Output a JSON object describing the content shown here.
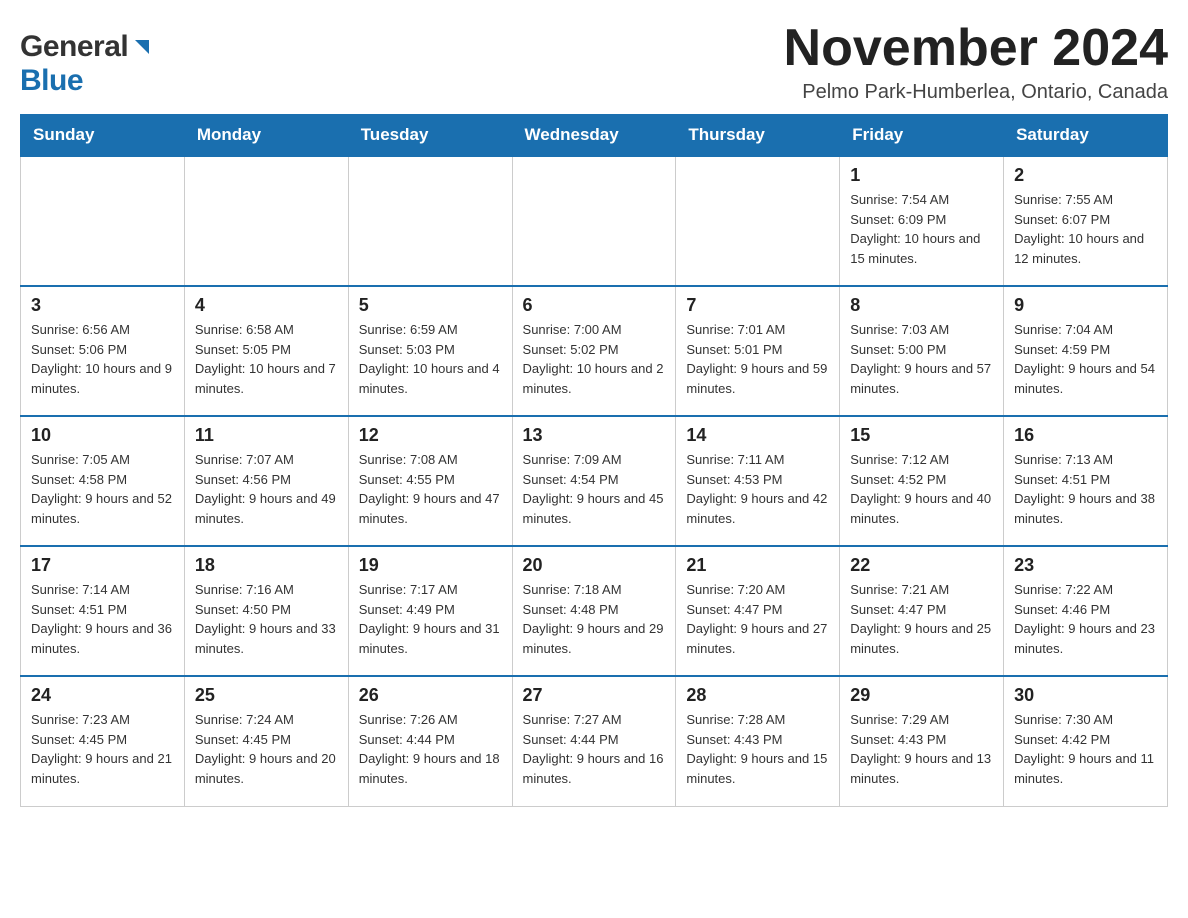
{
  "logo": {
    "text_general": "General",
    "triangle_symbol": "▶",
    "text_blue": "Blue"
  },
  "title": "November 2024",
  "location": "Pelmo Park-Humberlea, Ontario, Canada",
  "weekdays": [
    "Sunday",
    "Monday",
    "Tuesday",
    "Wednesday",
    "Thursday",
    "Friday",
    "Saturday"
  ],
  "weeks": [
    [
      {
        "day": "",
        "sunrise": "",
        "sunset": "",
        "daylight": ""
      },
      {
        "day": "",
        "sunrise": "",
        "sunset": "",
        "daylight": ""
      },
      {
        "day": "",
        "sunrise": "",
        "sunset": "",
        "daylight": ""
      },
      {
        "day": "",
        "sunrise": "",
        "sunset": "",
        "daylight": ""
      },
      {
        "day": "",
        "sunrise": "",
        "sunset": "",
        "daylight": ""
      },
      {
        "day": "1",
        "sunrise": "Sunrise: 7:54 AM",
        "sunset": "Sunset: 6:09 PM",
        "daylight": "Daylight: 10 hours and 15 minutes."
      },
      {
        "day": "2",
        "sunrise": "Sunrise: 7:55 AM",
        "sunset": "Sunset: 6:07 PM",
        "daylight": "Daylight: 10 hours and 12 minutes."
      }
    ],
    [
      {
        "day": "3",
        "sunrise": "Sunrise: 6:56 AM",
        "sunset": "Sunset: 5:06 PM",
        "daylight": "Daylight: 10 hours and 9 minutes."
      },
      {
        "day": "4",
        "sunrise": "Sunrise: 6:58 AM",
        "sunset": "Sunset: 5:05 PM",
        "daylight": "Daylight: 10 hours and 7 minutes."
      },
      {
        "day": "5",
        "sunrise": "Sunrise: 6:59 AM",
        "sunset": "Sunset: 5:03 PM",
        "daylight": "Daylight: 10 hours and 4 minutes."
      },
      {
        "day": "6",
        "sunrise": "Sunrise: 7:00 AM",
        "sunset": "Sunset: 5:02 PM",
        "daylight": "Daylight: 10 hours and 2 minutes."
      },
      {
        "day": "7",
        "sunrise": "Sunrise: 7:01 AM",
        "sunset": "Sunset: 5:01 PM",
        "daylight": "Daylight: 9 hours and 59 minutes."
      },
      {
        "day": "8",
        "sunrise": "Sunrise: 7:03 AM",
        "sunset": "Sunset: 5:00 PM",
        "daylight": "Daylight: 9 hours and 57 minutes."
      },
      {
        "day": "9",
        "sunrise": "Sunrise: 7:04 AM",
        "sunset": "Sunset: 4:59 PM",
        "daylight": "Daylight: 9 hours and 54 minutes."
      }
    ],
    [
      {
        "day": "10",
        "sunrise": "Sunrise: 7:05 AM",
        "sunset": "Sunset: 4:58 PM",
        "daylight": "Daylight: 9 hours and 52 minutes."
      },
      {
        "day": "11",
        "sunrise": "Sunrise: 7:07 AM",
        "sunset": "Sunset: 4:56 PM",
        "daylight": "Daylight: 9 hours and 49 minutes."
      },
      {
        "day": "12",
        "sunrise": "Sunrise: 7:08 AM",
        "sunset": "Sunset: 4:55 PM",
        "daylight": "Daylight: 9 hours and 47 minutes."
      },
      {
        "day": "13",
        "sunrise": "Sunrise: 7:09 AM",
        "sunset": "Sunset: 4:54 PM",
        "daylight": "Daylight: 9 hours and 45 minutes."
      },
      {
        "day": "14",
        "sunrise": "Sunrise: 7:11 AM",
        "sunset": "Sunset: 4:53 PM",
        "daylight": "Daylight: 9 hours and 42 minutes."
      },
      {
        "day": "15",
        "sunrise": "Sunrise: 7:12 AM",
        "sunset": "Sunset: 4:52 PM",
        "daylight": "Daylight: 9 hours and 40 minutes."
      },
      {
        "day": "16",
        "sunrise": "Sunrise: 7:13 AM",
        "sunset": "Sunset: 4:51 PM",
        "daylight": "Daylight: 9 hours and 38 minutes."
      }
    ],
    [
      {
        "day": "17",
        "sunrise": "Sunrise: 7:14 AM",
        "sunset": "Sunset: 4:51 PM",
        "daylight": "Daylight: 9 hours and 36 minutes."
      },
      {
        "day": "18",
        "sunrise": "Sunrise: 7:16 AM",
        "sunset": "Sunset: 4:50 PM",
        "daylight": "Daylight: 9 hours and 33 minutes."
      },
      {
        "day": "19",
        "sunrise": "Sunrise: 7:17 AM",
        "sunset": "Sunset: 4:49 PM",
        "daylight": "Daylight: 9 hours and 31 minutes."
      },
      {
        "day": "20",
        "sunrise": "Sunrise: 7:18 AM",
        "sunset": "Sunset: 4:48 PM",
        "daylight": "Daylight: 9 hours and 29 minutes."
      },
      {
        "day": "21",
        "sunrise": "Sunrise: 7:20 AM",
        "sunset": "Sunset: 4:47 PM",
        "daylight": "Daylight: 9 hours and 27 minutes."
      },
      {
        "day": "22",
        "sunrise": "Sunrise: 7:21 AM",
        "sunset": "Sunset: 4:47 PM",
        "daylight": "Daylight: 9 hours and 25 minutes."
      },
      {
        "day": "23",
        "sunrise": "Sunrise: 7:22 AM",
        "sunset": "Sunset: 4:46 PM",
        "daylight": "Daylight: 9 hours and 23 minutes."
      }
    ],
    [
      {
        "day": "24",
        "sunrise": "Sunrise: 7:23 AM",
        "sunset": "Sunset: 4:45 PM",
        "daylight": "Daylight: 9 hours and 21 minutes."
      },
      {
        "day": "25",
        "sunrise": "Sunrise: 7:24 AM",
        "sunset": "Sunset: 4:45 PM",
        "daylight": "Daylight: 9 hours and 20 minutes."
      },
      {
        "day": "26",
        "sunrise": "Sunrise: 7:26 AM",
        "sunset": "Sunset: 4:44 PM",
        "daylight": "Daylight: 9 hours and 18 minutes."
      },
      {
        "day": "27",
        "sunrise": "Sunrise: 7:27 AM",
        "sunset": "Sunset: 4:44 PM",
        "daylight": "Daylight: 9 hours and 16 minutes."
      },
      {
        "day": "28",
        "sunrise": "Sunrise: 7:28 AM",
        "sunset": "Sunset: 4:43 PM",
        "daylight": "Daylight: 9 hours and 15 minutes."
      },
      {
        "day": "29",
        "sunrise": "Sunrise: 7:29 AM",
        "sunset": "Sunset: 4:43 PM",
        "daylight": "Daylight: 9 hours and 13 minutes."
      },
      {
        "day": "30",
        "sunrise": "Sunrise: 7:30 AM",
        "sunset": "Sunset: 4:42 PM",
        "daylight": "Daylight: 9 hours and 11 minutes."
      }
    ]
  ]
}
